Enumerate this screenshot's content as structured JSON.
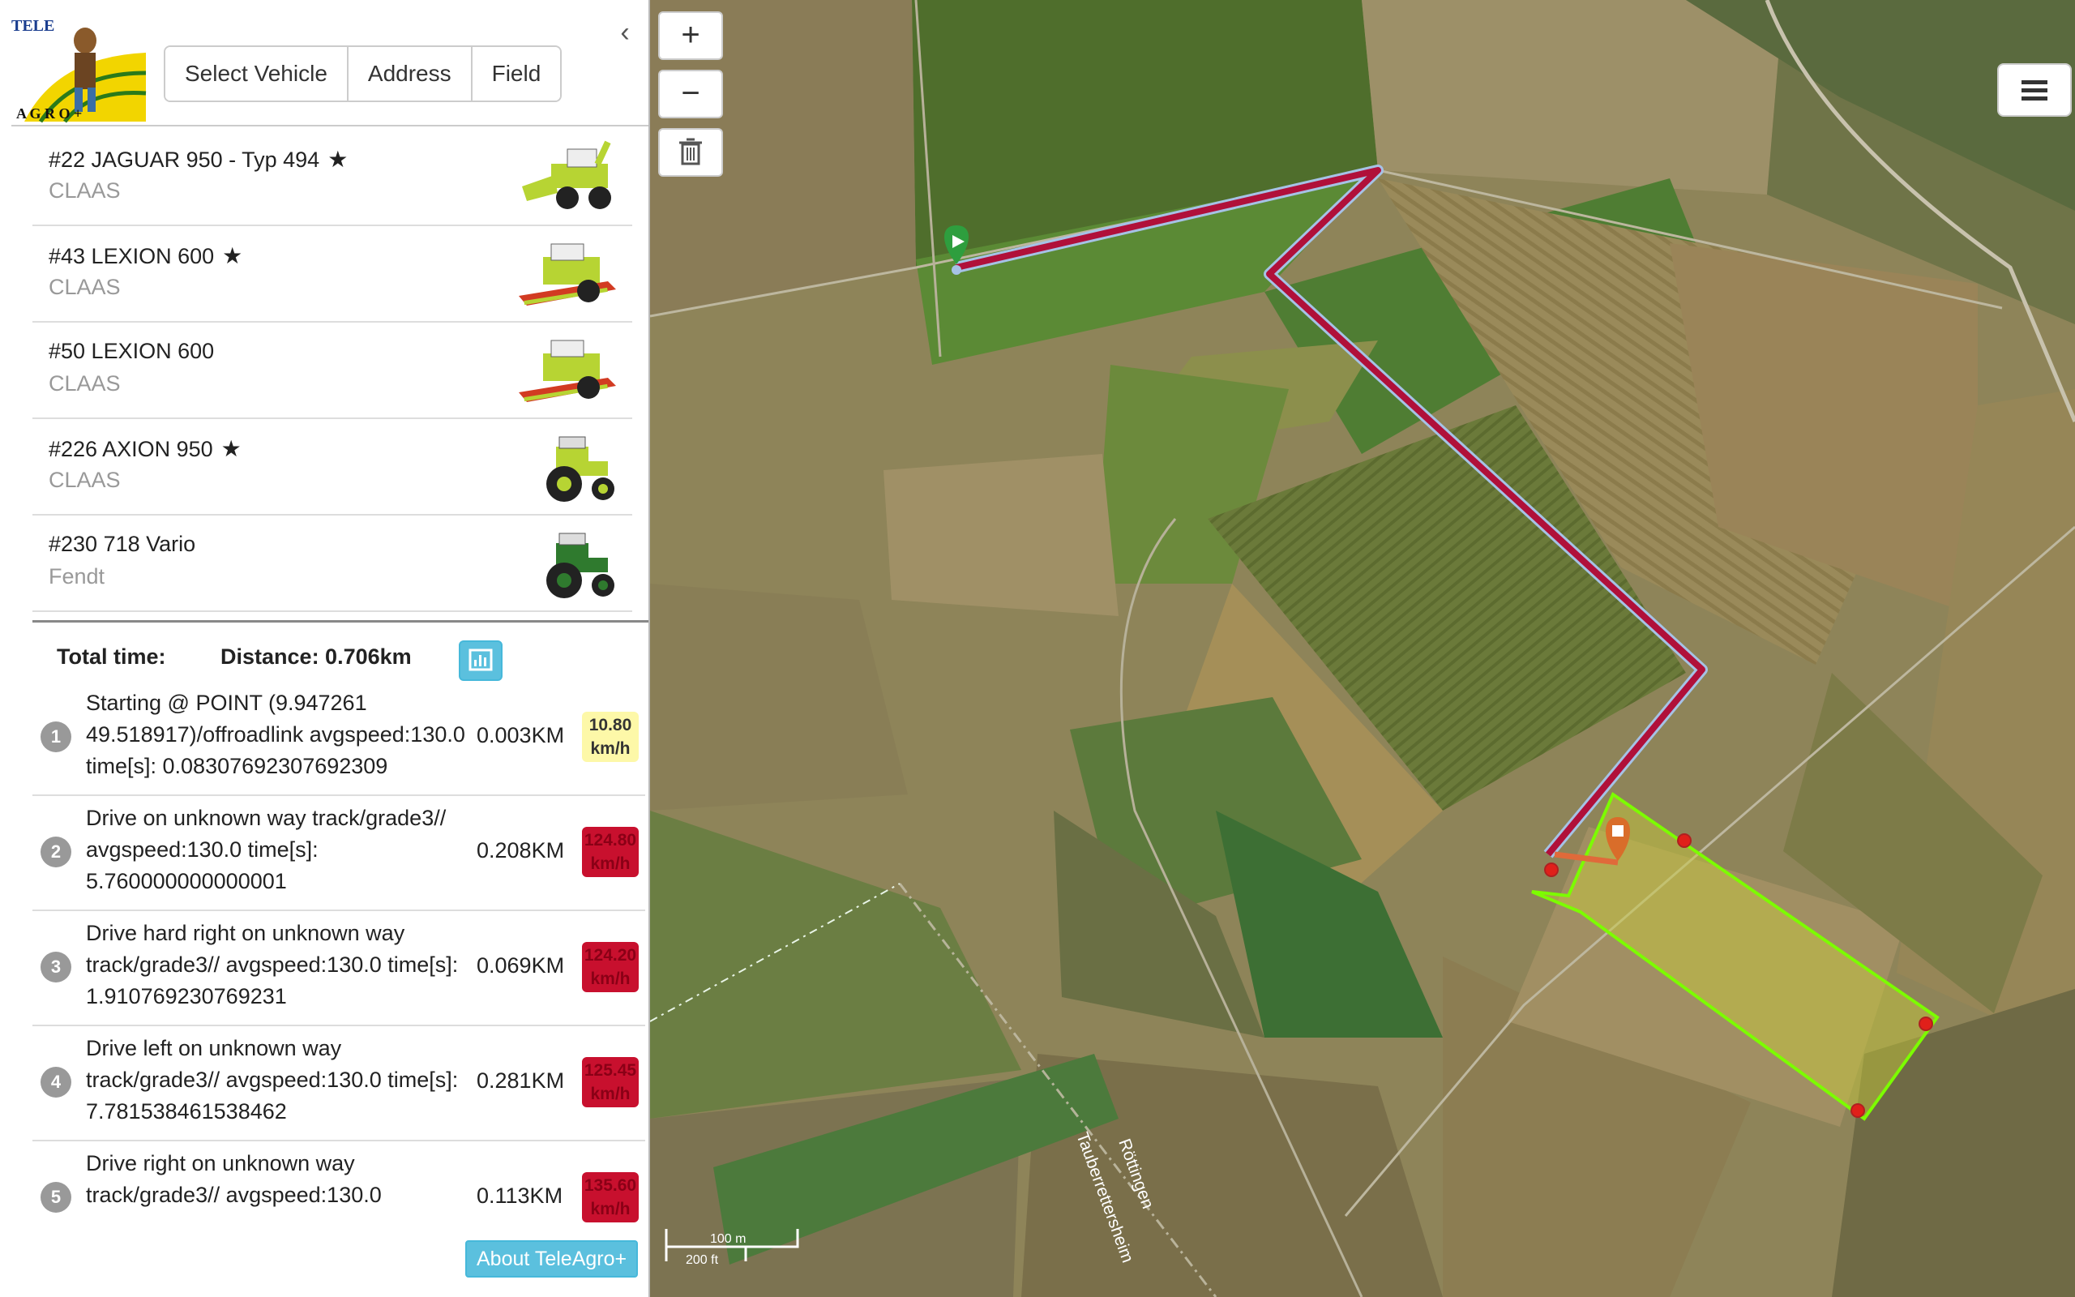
{
  "toolbar": {
    "select_vehicle": "Select Vehicle",
    "address": "Address",
    "field": "Field"
  },
  "logo": {
    "text_top": "TELE",
    "text_bottom": "A G R O +"
  },
  "vehicles": [
    {
      "name": "#22 JAGUAR 950 - Typ 494",
      "brand": "CLAAS",
      "favorite": true,
      "icon": "forage-harvester-icon"
    },
    {
      "name": "#43 LEXION 600",
      "brand": "CLAAS",
      "favorite": true,
      "icon": "combine-harvester-icon"
    },
    {
      "name": "#50 LEXION 600",
      "brand": "CLAAS",
      "favorite": false,
      "icon": "combine-harvester-icon"
    },
    {
      "name": "#226 AXION 950",
      "brand": "CLAAS",
      "favorite": true,
      "icon": "tractor-icon"
    },
    {
      "name": "#230 718 Vario",
      "brand": "Fendt",
      "favorite": false,
      "icon": "tractor-icon"
    }
  ],
  "summary": {
    "total_time": "Total time:",
    "distance": "Distance: 0.706km"
  },
  "steps": [
    {
      "num": "1",
      "text": "Starting @ POINT (9.947261 49.518917)/offroadlink avgspeed:130.0 time[s]: 0.08307692307692309",
      "dist": "0.003KM",
      "speed": "10.80",
      "unit": "km/h",
      "level": "ok"
    },
    {
      "num": "2",
      "text": "Drive on unknown way track/grade3// avgspeed:130.0 time[s]: 5.760000000000001",
      "dist": "0.208KM",
      "speed": "124.80",
      "unit": "km/h",
      "level": "bad"
    },
    {
      "num": "3",
      "text": "Drive hard right on unknown way track/grade3// avgspeed:130.0 time[s]: 1.910769230769231",
      "dist": "0.069KM",
      "speed": "124.20",
      "unit": "km/h",
      "level": "bad"
    },
    {
      "num": "4",
      "text": "Drive left on unknown way track/grade3// avgspeed:130.0 time[s]: 7.781538461538462",
      "dist": "0.281KM",
      "speed": "125.45",
      "unit": "km/h",
      "level": "bad"
    },
    {
      "num": "5",
      "text": "Drive right on unknown way track/grade3// avgspeed:130.0",
      "dist": "0.113KM",
      "speed": "135.60",
      "unit": "km/h",
      "level": "bad"
    }
  ],
  "about": "About TeleAgro+",
  "map": {
    "zoom_in": "+",
    "zoom_out": "−",
    "scale_m": "100 m",
    "scale_ft": "200 ft",
    "place_label_1": "Röttingen",
    "place_label_2": "Tauberrettersheim",
    "route_color": "#b0103a",
    "field_color": "#7cfc00"
  }
}
